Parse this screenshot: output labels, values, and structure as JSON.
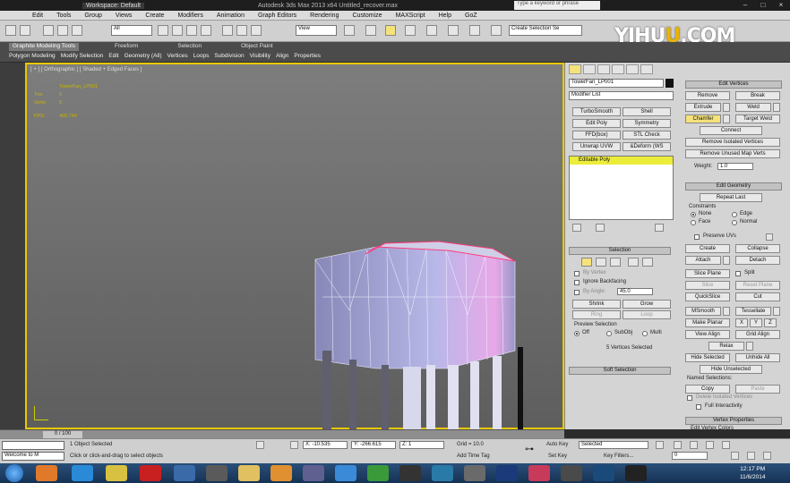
{
  "titlebar": {
    "workspace": "Workspace: Default",
    "app_title": "Autodesk 3ds Max 2013 x64    Untitled_recover.max",
    "search_placeholder": "Type a keyword or phrase"
  },
  "menu": [
    "Edit",
    "Tools",
    "Group",
    "Views",
    "Create",
    "Modifiers",
    "Animation",
    "Graph Editors",
    "Rendering",
    "Customize",
    "MAXScript",
    "Help",
    "GoZ"
  ],
  "toolbar": {
    "filter_select": "All",
    "view_select": "View",
    "selection_set": "Create Selection Se"
  },
  "watermark": {
    "a": "YIHU",
    "b": "U",
    "c": ".COM"
  },
  "ribbon": {
    "tabs": [
      "Graphite Modeling Tools",
      "Freeform",
      "Selection",
      "Object Paint"
    ],
    "subtabs": [
      "Polygon Modeling",
      "Modify Selection",
      "Edit",
      "Geometry (All)",
      "Vertices",
      "Loops",
      "Subdivision",
      "Visibility",
      "Align",
      "Properties"
    ]
  },
  "viewport": {
    "label": "[ + ] [ Orthographic ] [ Shaded + Edged Faces ]",
    "object_name": "TowerFan_LP001",
    "stats": [
      {
        "k": "Tris:",
        "v": "0"
      },
      {
        "k": "Verts:",
        "v": "5"
      },
      {
        "k": "FPS:",
        "v": "405.740"
      }
    ]
  },
  "command_panel": {
    "object_name": "TowerFan_LP001",
    "modifier_list": "Modifier List",
    "modifier_buttons": [
      "TurboSmooth",
      "Shell",
      "Edit Poly",
      "Symmetry",
      "FFD(box)",
      "STL Check",
      "Unwrap UVW",
      "&Deform (WS"
    ],
    "stack_item": "Editable Poly",
    "selection": {
      "header": "Selection",
      "by_vertex": "By Vertex",
      "ignore_backfacing": "Ignore Backfacing",
      "by_angle": "By Angle:",
      "angle_value": "45.0",
      "shrink": "Shrink",
      "grow": "Grow",
      "ring": "Ring",
      "loop": "Loop",
      "preview": "Preview Selection",
      "off": "Off",
      "subobj": "SubObj",
      "multi": "Multi",
      "status": "5 Vertices Selected"
    },
    "soft_selection": "Soft Selection",
    "edit_vertices": {
      "header": "Edit Vertices",
      "remove": "Remove",
      "break": "Break",
      "extrude": "Extrude",
      "weld": "Weld",
      "chamfer": "Chamfer",
      "target_weld": "Target Weld",
      "connect": "Connect",
      "remove_isolated": "Remove Isolated Vertices",
      "remove_unused": "Remove Unused Map Verts",
      "weight_label": "Weight:",
      "weight_value": "1.0"
    },
    "edit_geometry": {
      "header": "Edit Geometry",
      "repeat_last": "Repeat Last",
      "constraints": "Constraints",
      "none": "None",
      "edge": "Edge",
      "face": "Face",
      "normal": "Normal",
      "preserve_uvs": "Preserve UVs",
      "create": "Create",
      "collapse": "Collapse",
      "attach": "Attach",
      "detach": "Detach",
      "slice_plane": "Slice Plane",
      "split": "Split",
      "slice": "Slice",
      "reset_plane": "Reset Plane",
      "quickslice": "QuickSlice",
      "cut": "Cut",
      "msmooth": "MSmooth",
      "tessellate": "Tessellate",
      "make_planar": "Make Planar",
      "x": "X",
      "y": "Y",
      "z": "Z",
      "view_align": "View Align",
      "grid_align": "Grid Align",
      "relax": "Relax",
      "hide_selected": "Hide Selected",
      "unhide_all": "Unhide All",
      "hide_unselected": "Hide Unselected",
      "named_selections": "Named Selections:",
      "copy": "Copy",
      "paste": "Paste",
      "delete_isolated": "Delete Isolated Vertices",
      "full_interactivity": "Full Interactivity"
    },
    "vertex_properties": "Vertex Properties",
    "edit_vertex_colors": "Edit Vertex Colors"
  },
  "timeline": {
    "frame": "0 / 100"
  },
  "status": {
    "welcome": "Welcome to M",
    "objects_selected": "1 Object Selected",
    "prompt": "Click or click-and-drag to select objects",
    "x": "X: -10.535",
    "y": "Y: -266.615",
    "z": "Z: 1",
    "grid": "Grid = 10.0",
    "add_time_tag": "Add Time Tag",
    "auto_key": "Auto Key",
    "set_key": "Set Key",
    "selected": "Selected",
    "key_filters": "Key Filters...",
    "frame_field": "0"
  },
  "taskbar": {
    "time": "12:17 PM",
    "date": "11/6/2014"
  },
  "colors": {
    "accent_yellow": "#e8c800",
    "stack_yellow": "#ecec3a",
    "viewport_top": "#7d7d7d"
  }
}
